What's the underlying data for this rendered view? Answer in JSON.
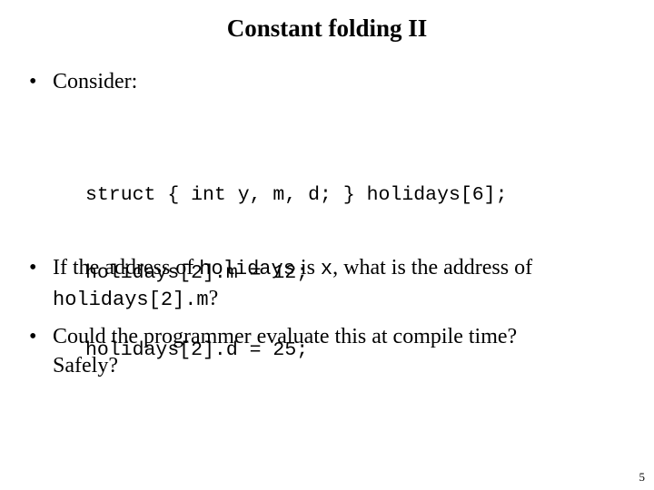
{
  "slide": {
    "title": "Constant folding II",
    "page_number": "5",
    "bullet_marker": "•",
    "bullets": [
      {
        "id": "consider",
        "text": "Consider:"
      }
    ],
    "code": {
      "lines": [
        "struct { int y, m, d; } holidays[6];",
        "holidays[2].m = 12;",
        "holidays[2].d = 25;"
      ]
    },
    "bullet_address": {
      "part1": "If the address of ",
      "mono1": "holidays",
      "part2": " is ",
      "mono2": "x",
      "part3": ", what is the address of",
      "cont_mono": "holidays[2].m",
      "cont_tail": "?"
    },
    "bullet_compile": {
      "line1": "Could the programmer evaluate this at compile time?",
      "line2": "Safely?"
    }
  }
}
